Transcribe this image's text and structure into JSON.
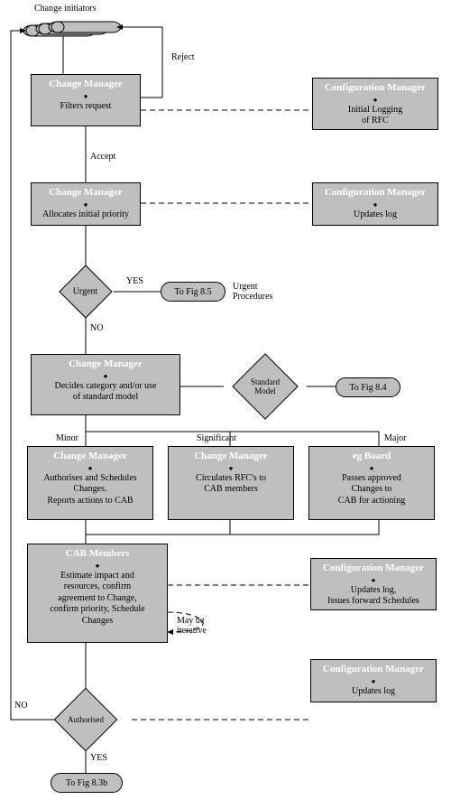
{
  "initiators": "Change initiators",
  "cm1": {
    "title": "Change Manager",
    "body": "Filters request"
  },
  "cfg1": {
    "title": "Configuration Manager",
    "body1": "Initial Logging",
    "body2": "of RFC"
  },
  "reject": "Reject",
  "accept": "Accept",
  "cm2": {
    "title": "Change Manager",
    "body": "Allocates initial priority"
  },
  "cfg2": {
    "title": "Configuration Manager",
    "body": "Updates log"
  },
  "urgent": "Urgent",
  "yes": "YES",
  "no": "NO",
  "pill85": "To Fig 8.5",
  "urgentProc": "Urgent\nProcedures",
  "cm3": {
    "title": "Change Manager",
    "body1": "Decides category and/or use",
    "body2": "of standard model"
  },
  "stdModel": "Standard Model",
  "pill84": "To Fig 8.4",
  "minor": "Minor",
  "significant": "Significant",
  "major": "Major",
  "cm4": {
    "title": "Change Manager",
    "body1": "Authorises and Schedules",
    "body2": "Changes.",
    "body3": "Reports actions to CAB"
  },
  "cm5": {
    "title": "Change Manager",
    "body1": "Circulates RFC's to",
    "body2": "CAB members"
  },
  "board": {
    "title": "eg Board",
    "body1": "Passes approved",
    "body2": "Changes to",
    "body3": "CAB for actioning"
  },
  "cab": {
    "title": "CAB Members",
    "body1": "Estimate impact and",
    "body2": "resources, confirm",
    "body3": "agreement to Change,",
    "body4": "confirm priority, Schedule",
    "body5": "Changes"
  },
  "cfg3": {
    "title": "Configuration Manager",
    "body1": "Updates log,",
    "body2": "Issues forward Schedules"
  },
  "cfg4": {
    "title": "Configuration Manager",
    "body": "Updates log"
  },
  "iterative": "May be\niterative",
  "authorised": "Authorised",
  "pill83b": "To Fig 8.3b"
}
